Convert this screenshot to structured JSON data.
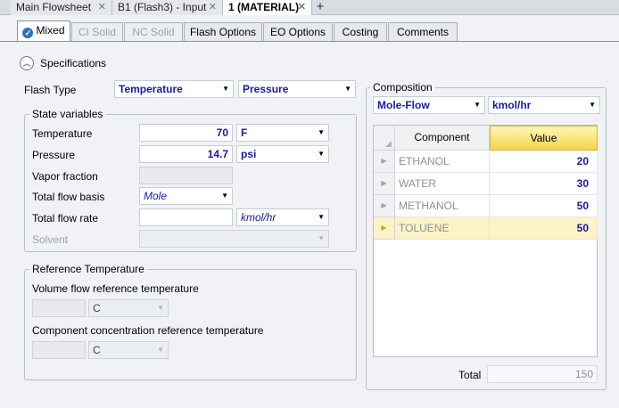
{
  "doc_tabs": [
    {
      "label": "Main Flowsheet"
    },
    {
      "label": "B1 (Flash3) - Input"
    },
    {
      "label": "1 (MATERIAL)"
    }
  ],
  "form_tabs": [
    {
      "label": "Mixed"
    },
    {
      "label": "CI Solid"
    },
    {
      "label": "NC Solid"
    },
    {
      "label": "Flash Options"
    },
    {
      "label": "EO Options"
    },
    {
      "label": "Costing"
    },
    {
      "label": "Comments"
    }
  ],
  "specifications": {
    "section_label": "Specifications",
    "flash_type_label": "Flash Type",
    "flash_type_1": "Temperature",
    "flash_type_2": "Pressure"
  },
  "state_variables": {
    "title": "State variables",
    "temperature": {
      "label": "Temperature",
      "value": "70",
      "unit": "F"
    },
    "pressure": {
      "label": "Pressure",
      "value": "14.7",
      "unit": "psi"
    },
    "vapor_fraction": {
      "label": "Vapor fraction",
      "value": ""
    },
    "total_flow_basis": {
      "label": "Total flow basis",
      "value": "Mole"
    },
    "total_flow_rate": {
      "label": "Total flow rate",
      "value": "",
      "unit": "kmol/hr"
    },
    "solvent": {
      "label": "Solvent",
      "value": ""
    }
  },
  "reference_temperature": {
    "title": "Reference Temperature",
    "volume_flow_label": "Volume flow reference temperature",
    "volume_flow_unit": "C",
    "component_conc_label": "Component concentration reference temperature",
    "component_conc_unit": "C"
  },
  "composition": {
    "title": "Composition",
    "basis": "Mole-Flow",
    "unit": "kmol/hr",
    "columns": [
      "Component",
      "Value"
    ],
    "rows": [
      {
        "component": "ETHANOL",
        "value": "20"
      },
      {
        "component": "WATER",
        "value": "30"
      },
      {
        "component": "METHANOL",
        "value": "50"
      },
      {
        "component": "TOLUENE",
        "value": "50"
      }
    ],
    "total_label": "Total",
    "total_value": "150"
  },
  "colors": {
    "accent_blue": "#1a1aa0",
    "selected_row": "#fdf3c4",
    "value_header": "#f5d54a"
  }
}
